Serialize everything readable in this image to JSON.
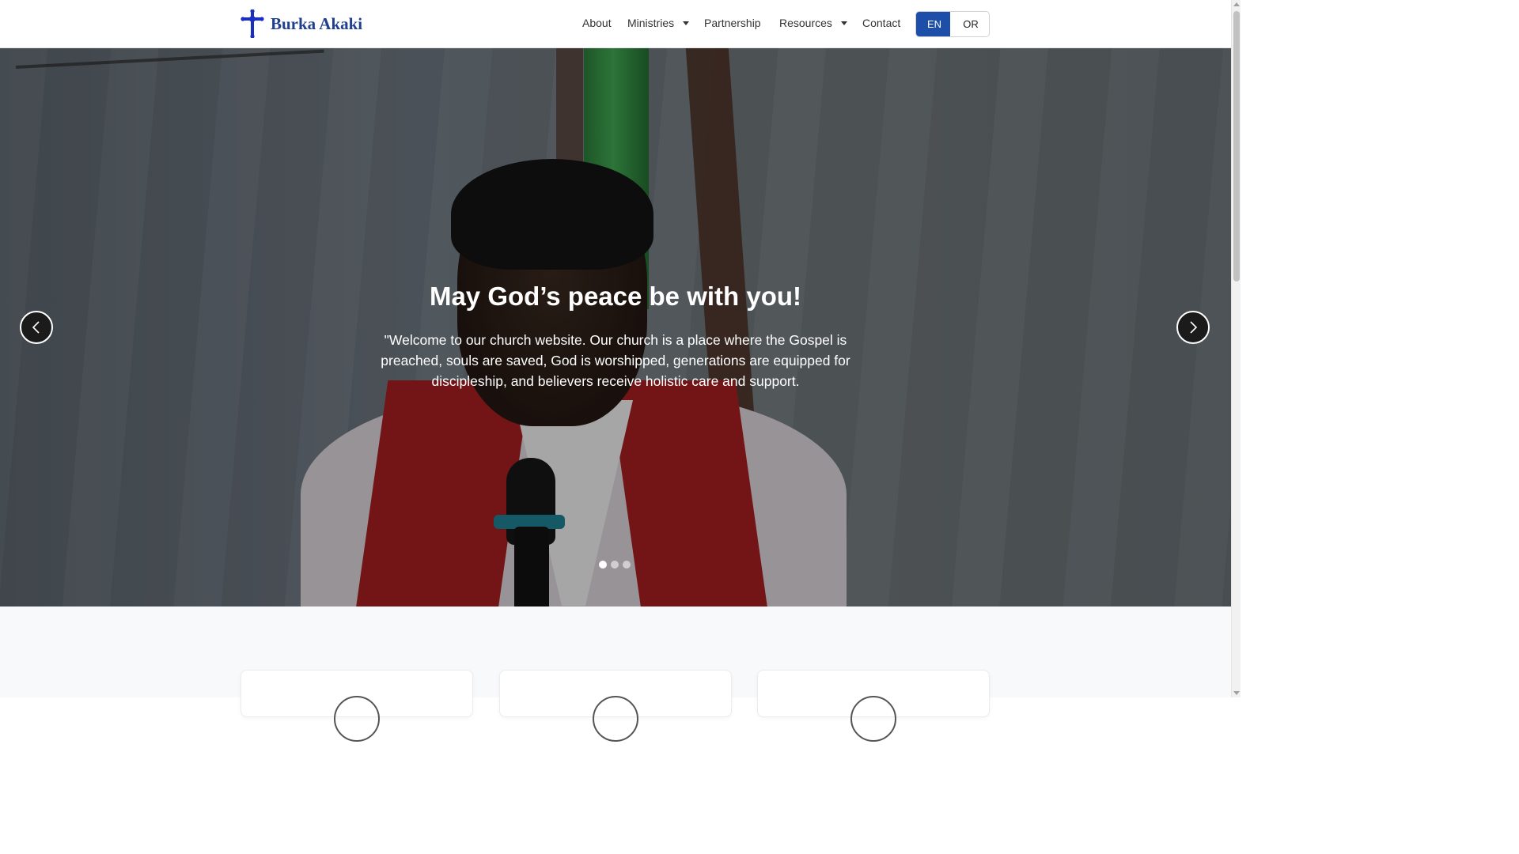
{
  "brand": {
    "name": "Burka Akaki",
    "logo_icon": "cross-icon",
    "logo_color": "#1a2fbf"
  },
  "nav": {
    "items": [
      {
        "label": "About",
        "has_dropdown": false
      },
      {
        "label": "Ministries",
        "has_dropdown": true,
        "icon": "",
        "caret": true
      },
      {
        "label": "Partnership",
        "has_dropdown": true,
        "icon": "",
        "caret": false
      },
      {
        "label": "Resources",
        "has_dropdown": true,
        "icon": "",
        "caret": true
      },
      {
        "label": "Contact",
        "has_dropdown": false
      }
    ],
    "languages": [
      {
        "icon": "",
        "label": "EN",
        "active": true
      },
      {
        "icon": "",
        "label": "OR",
        "active": false
      }
    ]
  },
  "hero": {
    "title": "May God’s peace be with you!",
    "text": "\"Welcome to our church website. Our church is a place where the Gospel is preached, souls are saved, God is worshipped, generations are equipped for discipleship, and believers receive holistic care and support.",
    "slide_count": 3,
    "active_slide": 1,
    "prev_icon": "chevron-left-icon",
    "next_icon": "chevron-right-icon"
  },
  "colors": {
    "accent": "#1e4fa8",
    "brand_text": "#1f3f8f"
  }
}
